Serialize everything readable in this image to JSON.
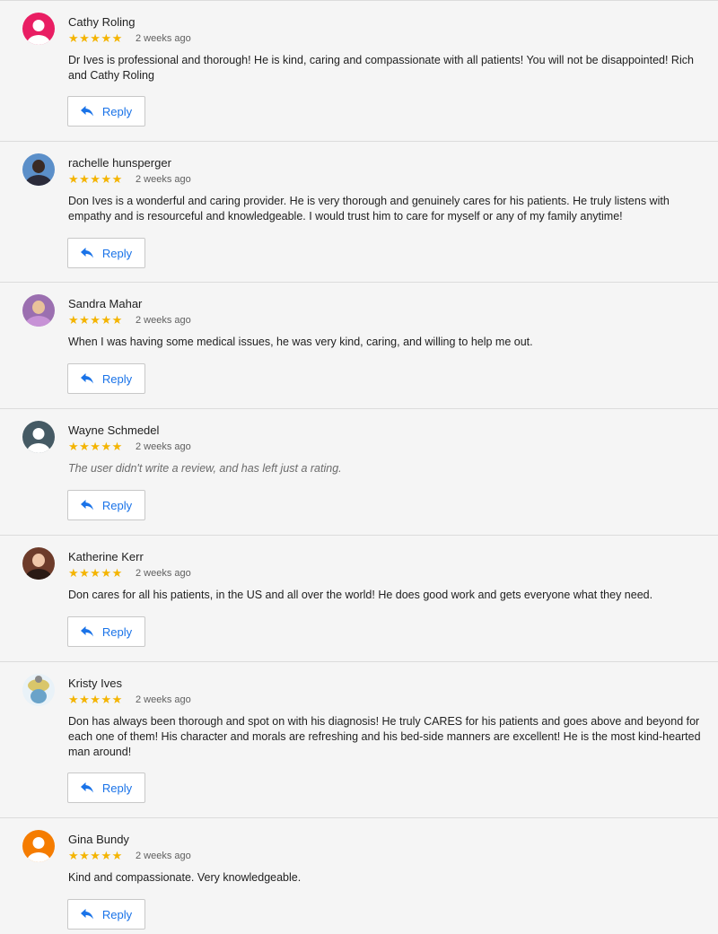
{
  "rating_stars": "★★★★★",
  "reply_label": "Reply",
  "reviews": [
    {
      "name": "Cathy Roling",
      "date": "2 weeks ago",
      "text": "Dr Ives is professional and thorough! He is kind, caring and compassionate with all patients! You will not be disappointed! Rich and Cathy Roling",
      "avatar_color": "#e91e63"
    },
    {
      "name": "rachelle hunsperger",
      "date": "2 weeks ago",
      "text": "Don Ives is a wonderful and caring provider. He is very thorough and genuinely cares for his patients. He truly listens with empathy and is resourceful and knowledgeable. I would trust him to care for myself or any of my family anytime!",
      "avatar_color": "#5b8fc9"
    },
    {
      "name": "Sandra Mahar",
      "date": "2 weeks ago",
      "text": "When I was having some medical issues, he was very kind, caring, and willing to help me out.",
      "avatar_color": "#9b6fb0"
    },
    {
      "name": "Wayne Schmedel",
      "date": "2 weeks ago",
      "text": "The user didn't write a review, and has left just a rating.",
      "avatar_color": "#455a64"
    },
    {
      "name": "Katherine Kerr",
      "date": "2 weeks ago",
      "text": "Don cares for all his patients, in the US and all over the world! He does good work and gets everyone what they need.",
      "avatar_color": "#6d3b2a"
    },
    {
      "name": "Kristy Ives",
      "date": "2 weeks ago",
      "text": "Don has always been thorough and spot on with his diagnosis! He truly CARES for his patients and goes above and beyond for each one of them! His character and morals are refreshing and his bed-side manners are excellent! He is the most kind-hearted man around!",
      "avatar_color": "#e9f2f8"
    },
    {
      "name": "Gina Bundy",
      "date": "2 weeks ago",
      "text": "Kind and compassionate. Very knowledgeable.",
      "avatar_color": "#f57c00"
    }
  ]
}
